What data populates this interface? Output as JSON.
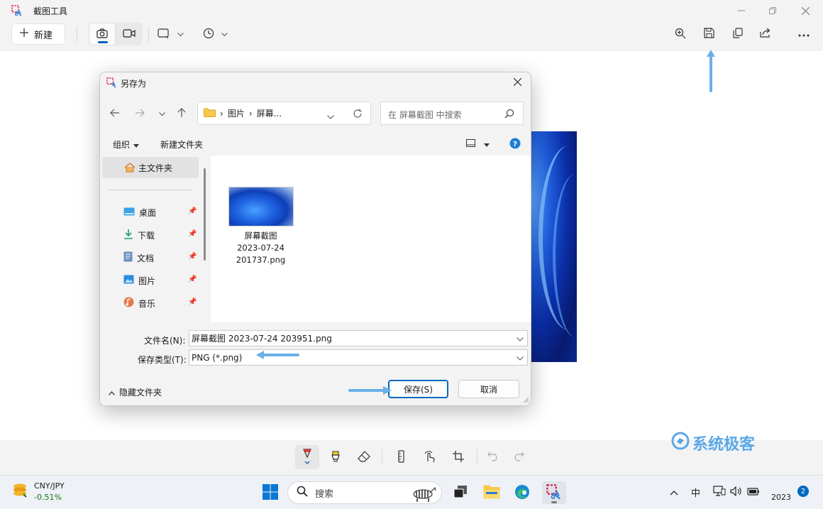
{
  "app": {
    "title": "截图工具",
    "new_label": "新建"
  },
  "dialog": {
    "title": "另存为",
    "breadcrumb": [
      "图片",
      "屏幕..."
    ],
    "search_placeholder": "在 屏幕截图 中搜索",
    "organize_label": "组织",
    "new_folder_label": "新建文件夹",
    "sidebar": {
      "home": "主文件夹",
      "items": [
        {
          "label": "桌面",
          "icon": "desktop-icon"
        },
        {
          "label": "下载",
          "icon": "download-icon"
        },
        {
          "label": "文档",
          "icon": "document-icon"
        },
        {
          "label": "图片",
          "icon": "pictures-icon"
        },
        {
          "label": "音乐",
          "icon": "music-icon"
        }
      ]
    },
    "file": {
      "line1": "屏幕截图",
      "line2": "2023-07-24",
      "line3": "201737.png"
    },
    "filename_label": "文件名(N):",
    "filename_value": "屏幕截图 2023-07-24 203951.png",
    "filetype_label": "保存类型(T):",
    "filetype_value": "PNG (*.png)",
    "save_button": "保存(S)",
    "cancel_button": "取消",
    "hide_folders": "隐藏文件夹"
  },
  "watermark": "系统极客",
  "taskbar": {
    "widget_title": "CNY/JPY",
    "widget_value": "-0.51%",
    "search_label": "搜索",
    "ime": "中",
    "clock": "2023",
    "notification_count": "2"
  },
  "colors": {
    "accent": "#0067c0",
    "annotation_arrow": "#5aa8e8",
    "widget_negative": "#0f7b0f"
  }
}
